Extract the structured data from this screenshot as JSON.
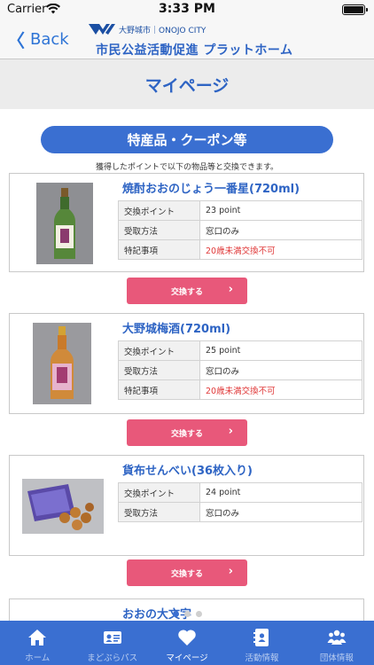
{
  "status_bar": {
    "carrier": "Carrier",
    "time": "3:33 PM"
  },
  "header": {
    "back_label": "Back",
    "city_name": "大野城市｜ONOJO CITY",
    "platform_title": "市民公益活動促進 プラットホーム"
  },
  "page_title": "マイページ",
  "section": {
    "title": "特産品・クーポン等",
    "note": "獲得したポイントで以下の物品等と交換できます。"
  },
  "products": [
    {
      "name": "焼酎おおのじょう一番星(720ml)",
      "image": "green-bottle-image",
      "specs": [
        {
          "key": "交換ポイント",
          "value": "23 point",
          "warn": false
        },
        {
          "key": "受取方法",
          "value": "窓口のみ",
          "warn": false
        },
        {
          "key": "特記事項",
          "value": "20歳未満交換不可",
          "warn": true
        }
      ],
      "button_label": "交換する"
    },
    {
      "name": "大野城梅酒(720ml)",
      "image": "umeshu-bottle-image",
      "specs": [
        {
          "key": "交換ポイント",
          "value": "25 point",
          "warn": false
        },
        {
          "key": "受取方法",
          "value": "窓口のみ",
          "warn": false
        },
        {
          "key": "特記事項",
          "value": "20歳未満交換不可",
          "warn": true
        }
      ],
      "button_label": "交換する"
    },
    {
      "name": "貨布せんべい(36枚入り)",
      "image": "senbei-box-image",
      "specs": [
        {
          "key": "交換ポイント",
          "value": "24 point",
          "warn": false
        },
        {
          "key": "受取方法",
          "value": "窓口のみ",
          "warn": false
        }
      ],
      "button_label": "交換する"
    },
    {
      "name": "おおの大文字",
      "image": "",
      "specs": [],
      "button_label": ""
    }
  ],
  "pager": {
    "count": 3,
    "active": 0
  },
  "tabs": [
    {
      "label": "ホーム",
      "icon": "home-icon",
      "active": false
    },
    {
      "label": "まどぷらパス",
      "icon": "id-card-icon",
      "active": false
    },
    {
      "label": "マイページ",
      "icon": "heart-icon",
      "active": true
    },
    {
      "label": "活動情報",
      "icon": "contacts-book-icon",
      "active": false
    },
    {
      "label": "団体情報",
      "icon": "group-icon",
      "active": false
    }
  ],
  "colors": {
    "accent": "#3a6fd1",
    "title_blue": "#2e64c4",
    "exchange_button": "#e8587a",
    "warning_text": "#e03a3a"
  }
}
